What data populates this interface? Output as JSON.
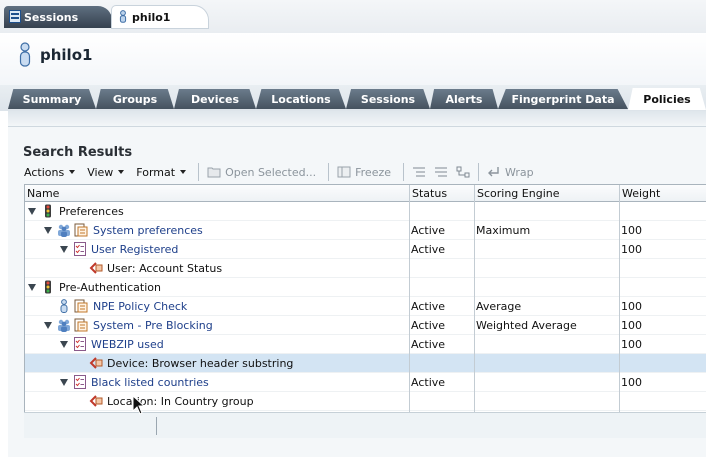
{
  "doc_tabs": [
    {
      "label": "Sessions",
      "icon": "sessions-icon"
    },
    {
      "label": "philo1",
      "icon": "user-icon"
    }
  ],
  "entity": {
    "title": "philo1",
    "icon": "user-icon"
  },
  "section_tabs": [
    "Summary",
    "Groups",
    "Devices",
    "Locations",
    "Sessions",
    "Alerts",
    "Fingerprint Data",
    "Policies"
  ],
  "active_section": "Policies",
  "search_results": {
    "title": "Search Results",
    "toolbar": {
      "actions": "Actions",
      "view": "View",
      "format": "Format",
      "open_selected": "Open Selected...",
      "freeze": "Freeze",
      "wrap": "Wrap"
    },
    "columns": [
      "Name",
      "Status",
      "Scoring Engine",
      "Weight"
    ],
    "rows": [
      {
        "name": "Preferences",
        "status": "",
        "engine": "",
        "weight": ""
      },
      {
        "name": "System preferences",
        "status": "Active",
        "engine": "Maximum",
        "weight": "100"
      },
      {
        "name": "User Registered",
        "status": "Active",
        "engine": "",
        "weight": "100"
      },
      {
        "name": "User: Account Status",
        "status": "",
        "engine": "",
        "weight": ""
      },
      {
        "name": "Pre-Authentication",
        "status": "",
        "engine": "",
        "weight": ""
      },
      {
        "name": "NPE Policy Check",
        "status": "Active",
        "engine": "Average",
        "weight": "100"
      },
      {
        "name": "System - Pre Blocking",
        "status": "Active",
        "engine": "Weighted Average",
        "weight": "100"
      },
      {
        "name": "WEBZIP used",
        "status": "Active",
        "engine": "",
        "weight": "100"
      },
      {
        "name": "Device: Browser header substring",
        "status": "",
        "engine": "",
        "weight": ""
      },
      {
        "name": "Black listed countries",
        "status": "Active",
        "engine": "",
        "weight": "100"
      },
      {
        "name": "Location: In Country group",
        "status": "",
        "engine": "",
        "weight": ""
      }
    ]
  },
  "colors": {
    "tab_dark": "#45525f",
    "link": "#1e3f8a",
    "selected_row": "#d3e4f3"
  }
}
